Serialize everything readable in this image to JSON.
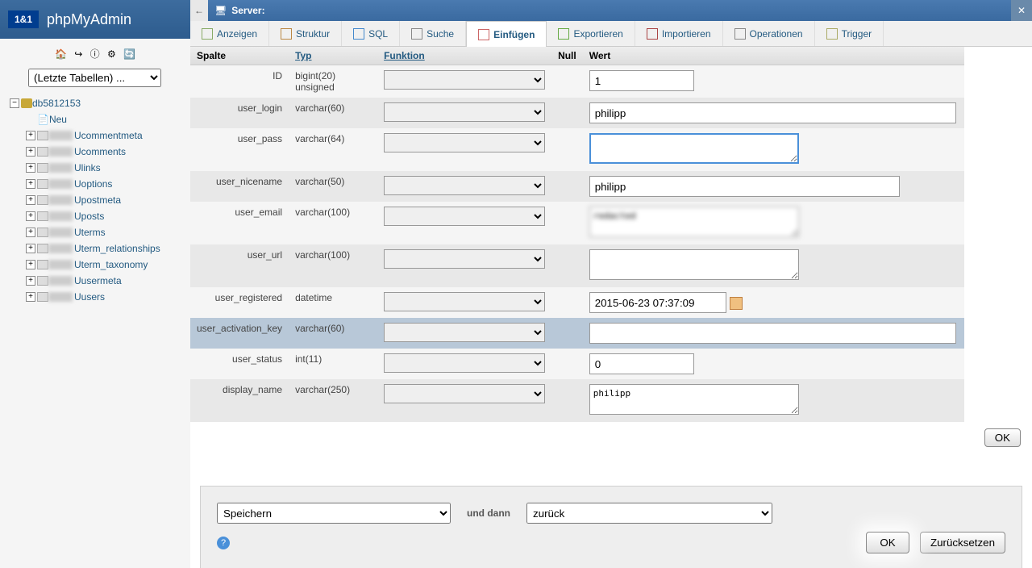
{
  "brand": {
    "box": "1&1",
    "name": "phpMyAdmin"
  },
  "sidebar": {
    "recent_tables": "(Letzte Tabellen) ...",
    "db": "db5812153",
    "neu": "Neu",
    "tables": [
      "Ucommentmeta",
      "Ucomments",
      "Ulinks",
      "Uoptions",
      "Upostmeta",
      "Uposts",
      "Uterms",
      "Uterm_relationships",
      "Uterm_taxonomy",
      "Uusermeta",
      "Uusers"
    ]
  },
  "topbar": {
    "server": "Server:"
  },
  "tabs": [
    "Anzeigen",
    "Struktur",
    "SQL",
    "Suche",
    "Einfügen",
    "Exportieren",
    "Importieren",
    "Operationen",
    "Trigger"
  ],
  "active_tab": "Einfügen",
  "table_headers": {
    "spalte": "Spalte",
    "typ": "Typ",
    "funktion": "Funktion",
    "null": "Null",
    "wert": "Wert"
  },
  "rows": [
    {
      "col": "ID",
      "typ": "bigint(20) unsigned",
      "value": "1",
      "kind": "input-narrow"
    },
    {
      "col": "user_login",
      "typ": "varchar(60)",
      "value": "philipp",
      "kind": "input-wide"
    },
    {
      "col": "user_pass",
      "typ": "varchar(64)",
      "value": "",
      "kind": "textarea-focus"
    },
    {
      "col": "user_nicename",
      "typ": "varchar(50)",
      "value": "philipp",
      "kind": "input-med"
    },
    {
      "col": "user_email",
      "typ": "varchar(100)",
      "value": "",
      "kind": "textarea-blur"
    },
    {
      "col": "user_url",
      "typ": "varchar(100)",
      "value": "",
      "kind": "textarea"
    },
    {
      "col": "user_registered",
      "typ": "datetime",
      "value": "2015-06-23 07:37:09",
      "kind": "input-date"
    },
    {
      "col": "user_activation_key",
      "typ": "varchar(60)",
      "value": "",
      "kind": "input-wide-sel"
    },
    {
      "col": "user_status",
      "typ": "int(11)",
      "value": "0",
      "kind": "input-narrow"
    },
    {
      "col": "display_name",
      "typ": "varchar(250)",
      "value": "philipp",
      "kind": "textarea"
    }
  ],
  "ok": "OK",
  "footer": {
    "speichern": "Speichern",
    "und_dann": "und dann",
    "zurueck": "zurück",
    "ok": "OK",
    "reset": "Zurücksetzen"
  }
}
